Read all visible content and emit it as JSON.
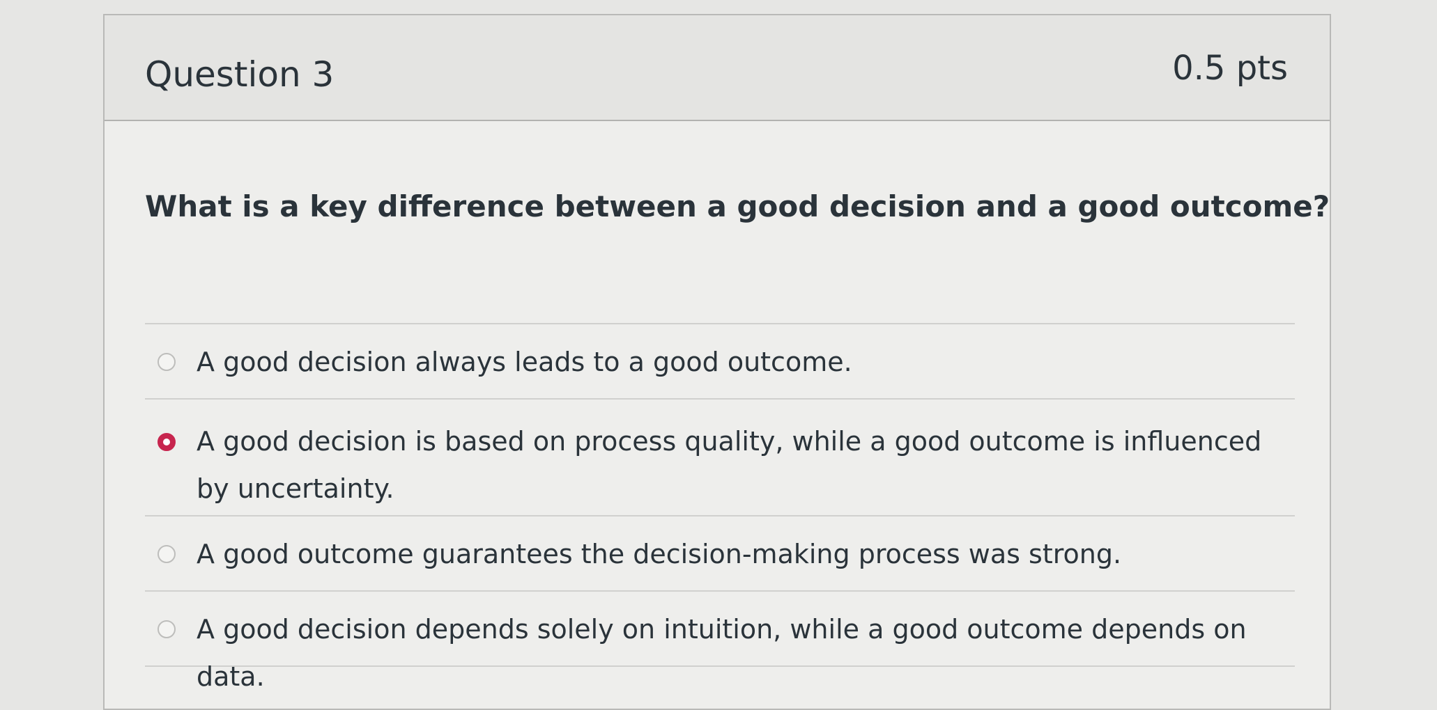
{
  "question": {
    "title": "Question 3",
    "points": "0.5 pts",
    "text": "What is a key difference between a good decision and a good outcome?"
  },
  "answers": [
    {
      "label": "A good decision always leads to a good outcome.",
      "selected": false
    },
    {
      "label": "A good decision is based on process quality, while a good outcome is influenced by uncertainty.",
      "selected": true
    },
    {
      "label": "A good outcome guarantees the decision-making process was strong.",
      "selected": false
    },
    {
      "label": "A good decision depends solely on intuition, while a good outcome depends on data.",
      "selected": false
    }
  ],
  "colors": {
    "selected_radio": "#c7254e",
    "text": "#2a333a",
    "header_bg": "#e4e4e2"
  }
}
